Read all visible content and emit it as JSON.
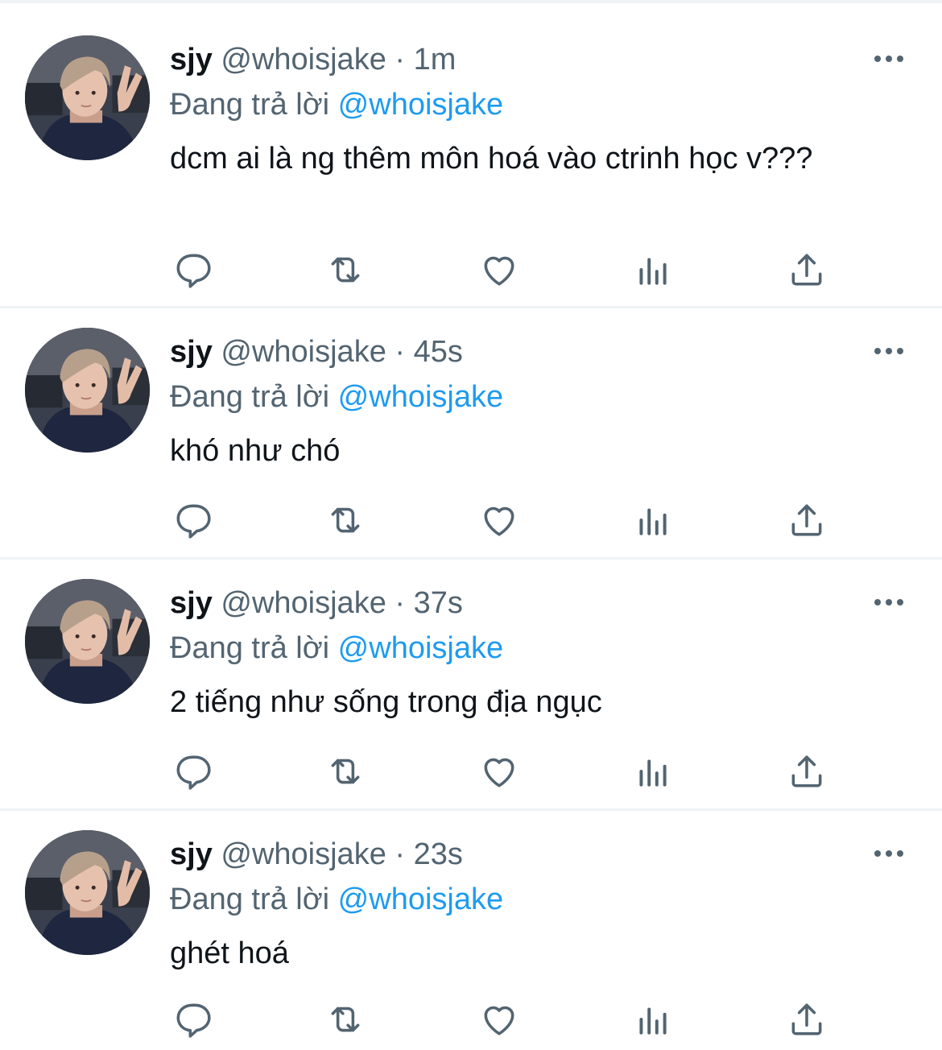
{
  "colors": {
    "text": "#0f1419",
    "secondary": "#536471",
    "accent": "#1d9bf0",
    "divider": "#eff3f4"
  },
  "icons": [
    "avatar",
    "more-icon",
    "reply-icon",
    "retweet-icon",
    "like-icon",
    "analytics-icon",
    "share-icon"
  ],
  "tweets": [
    {
      "name": "sjy",
      "handle": "@whoisjake",
      "dot": "·",
      "time": "1m",
      "reply_prefix": "Đang trả lời",
      "reply_to": "@whoisjake",
      "text": "dcm ai là ng thêm môn hoá vào ctrinh học v???"
    },
    {
      "name": "sjy",
      "handle": "@whoisjake",
      "dot": "·",
      "time": "45s",
      "reply_prefix": "Đang trả lời",
      "reply_to": "@whoisjake",
      "text": "khó như chó"
    },
    {
      "name": "sjy",
      "handle": "@whoisjake",
      "dot": "·",
      "time": "37s",
      "reply_prefix": "Đang trả lời",
      "reply_to": "@whoisjake",
      "text": "2 tiếng như sống trong địa ngục"
    },
    {
      "name": "sjy",
      "handle": "@whoisjake",
      "dot": "·",
      "time": "23s",
      "reply_prefix": "Đang trả lời",
      "reply_to": "@whoisjake",
      "text": "ghét hoá"
    }
  ]
}
